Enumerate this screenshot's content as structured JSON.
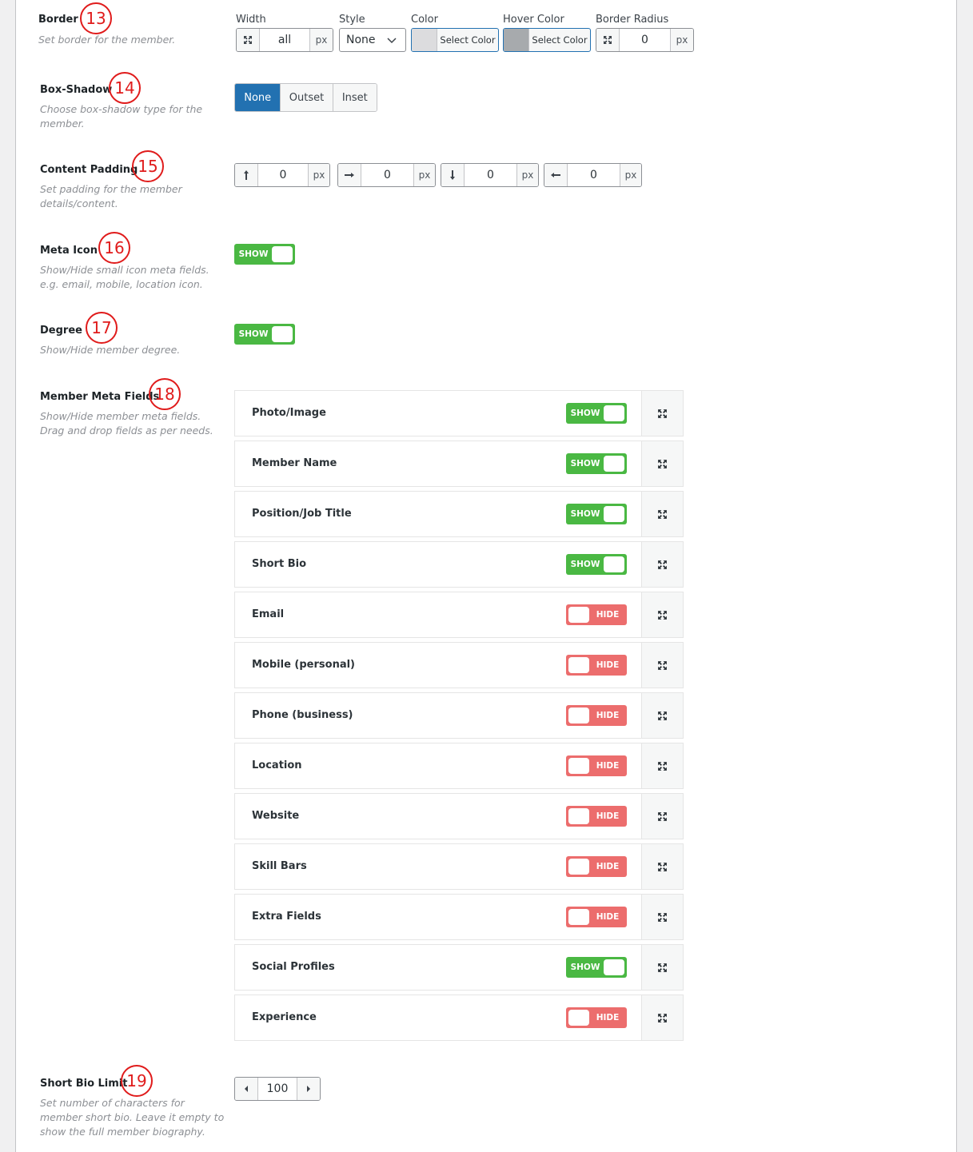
{
  "border": {
    "label": "Border",
    "desc": "Set border for the member.",
    "badge": "13",
    "width": {
      "label": "Width",
      "value": "all",
      "unit": "px",
      "icon": "expand-icon"
    },
    "style": {
      "label": "Style",
      "value": "None"
    },
    "color": {
      "label": "Color",
      "button": "Select Color",
      "swatch": "#dcdcde"
    },
    "hover_color": {
      "label": "Hover Color",
      "button": "Select Color",
      "swatch": "#a7aaad"
    },
    "radius": {
      "label": "Border Radius",
      "value": "0",
      "unit": "px",
      "icon": "expand-icon"
    }
  },
  "box_shadow": {
    "label": "Box-Shadow",
    "desc1": "Choose box-shadow type for the",
    "desc2": "member.",
    "badge": "14",
    "options": [
      "None",
      "Outset",
      "Inset"
    ],
    "selected": "None"
  },
  "content_padding": {
    "label": "Content Padding",
    "desc1": "Set padding for the member",
    "desc2": "details/content.",
    "badge": "15",
    "fields": [
      {
        "icon": "arrow-up-icon",
        "value": "0",
        "unit": "px"
      },
      {
        "icon": "arrow-right-icon",
        "value": "0",
        "unit": "px"
      },
      {
        "icon": "arrow-down-icon",
        "value": "0",
        "unit": "px"
      },
      {
        "icon": "arrow-left-icon",
        "value": "0",
        "unit": "px"
      }
    ]
  },
  "meta_icon": {
    "label": "Meta Icon",
    "desc1": "Show/Hide small icon meta fields.",
    "desc2": "e.g. email, mobile, location icon.",
    "badge": "16",
    "toggle": "SHOW"
  },
  "degree": {
    "label": "Degree",
    "desc": "Show/Hide member degree.",
    "badge": "17",
    "toggle": "SHOW"
  },
  "member_meta": {
    "label": "Member Meta Fields",
    "desc1": "Show/Hide member meta fields.",
    "desc2": "Drag and drop fields as per needs.",
    "badge": "18",
    "rows": [
      {
        "name": "Photo/Image",
        "state": "SHOW"
      },
      {
        "name": "Member Name",
        "state": "SHOW"
      },
      {
        "name": "Position/Job Title",
        "state": "SHOW"
      },
      {
        "name": "Short Bio",
        "state": "SHOW"
      },
      {
        "name": "Email",
        "state": "HIDE"
      },
      {
        "name": "Mobile (personal)",
        "state": "HIDE"
      },
      {
        "name": "Phone (business)",
        "state": "HIDE"
      },
      {
        "name": "Location",
        "state": "HIDE"
      },
      {
        "name": "Website",
        "state": "HIDE"
      },
      {
        "name": "Skill Bars",
        "state": "HIDE"
      },
      {
        "name": "Extra Fields",
        "state": "HIDE"
      },
      {
        "name": "Social Profiles",
        "state": "SHOW"
      },
      {
        "name": "Experience",
        "state": "HIDE"
      }
    ]
  },
  "short_bio_limit": {
    "label": "Short Bio Limit",
    "desc1": "Set number of characters for",
    "desc2": "member short bio. Leave it empty to",
    "desc3": "show the full member biography.",
    "badge": "19",
    "value": "100"
  },
  "colors": {
    "show": "#4ab843",
    "hide": "#ec6d6d",
    "accent": "#2271b1",
    "badge": "#e01b1b"
  }
}
